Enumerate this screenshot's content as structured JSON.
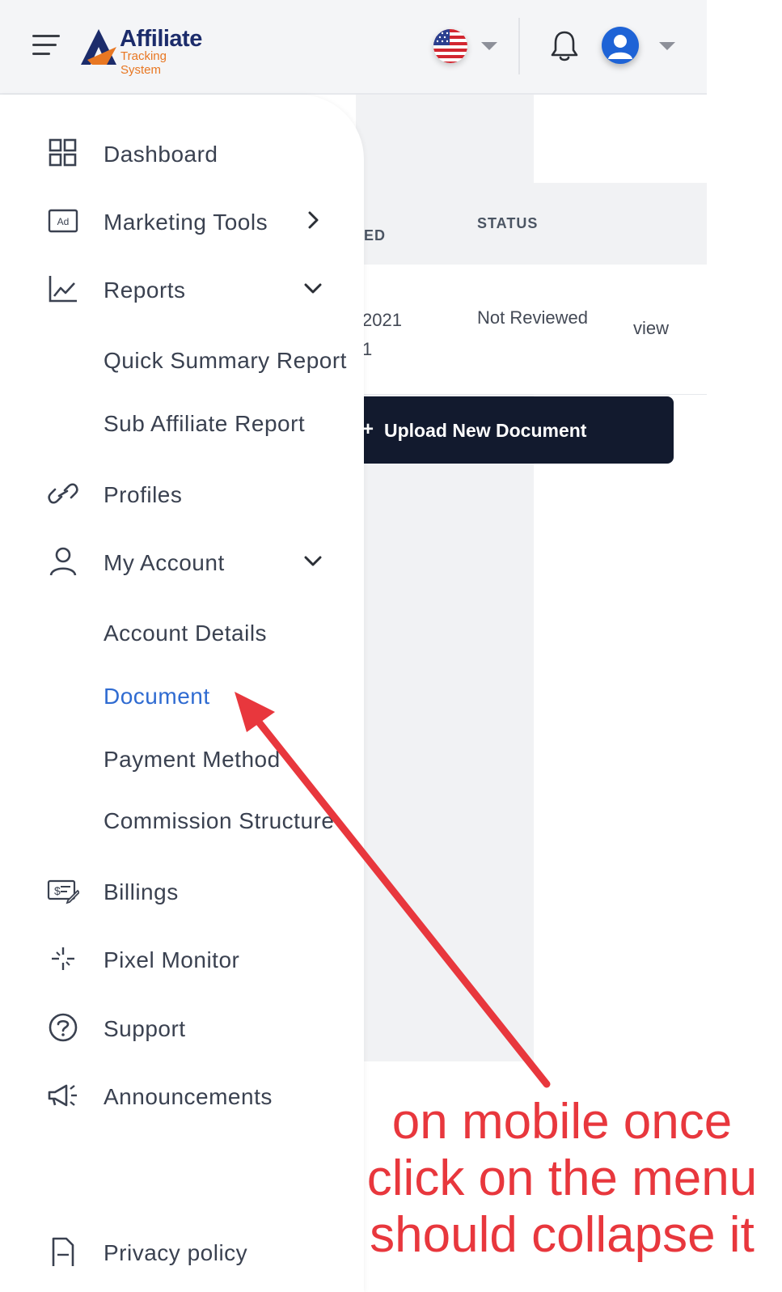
{
  "header": {
    "logo_main": "Affiliate",
    "logo_sub": "Tracking System"
  },
  "table": {
    "col_date_partial": "ED",
    "col_status": "STATUS",
    "row": {
      "date_line1": "2021",
      "date_line2": "1",
      "status": "Not Reviewed",
      "action": "view"
    }
  },
  "upload_button": {
    "icon": "+",
    "label": "Upload New Document"
  },
  "sidebar": {
    "items": [
      {
        "label": "Dashboard",
        "icon": "grid-icon"
      },
      {
        "label": "Marketing Tools",
        "icon": "ad-icon",
        "arrow": "chevron-right"
      },
      {
        "label": "Reports",
        "icon": "chart-line-icon",
        "arrow": "chevron-down"
      },
      {
        "label": "Profiles",
        "icon": "link-icon"
      },
      {
        "label": "My Account",
        "icon": "user-icon",
        "arrow": "chevron-down"
      },
      {
        "label": "Billings",
        "icon": "billing-icon"
      },
      {
        "label": "Pixel Monitor",
        "icon": "pixel-icon"
      },
      {
        "label": "Support",
        "icon": "question-circle-icon"
      },
      {
        "label": "Announcements",
        "icon": "megaphone-icon"
      },
      {
        "label": "Privacy policy",
        "icon": "document-icon"
      }
    ],
    "reports_sub": [
      "Quick Summary Report",
      "Sub Affiliate Report"
    ],
    "account_sub": [
      "Account Details",
      "Document",
      "Payment Method",
      "Commission Structure"
    ],
    "active_item": "Document",
    "active_color": "#2f6bd1"
  },
  "annotation": {
    "line1": "on mobile once",
    "line2": "click on the menu",
    "line3": "should collapse it",
    "color": "#e8373d"
  }
}
